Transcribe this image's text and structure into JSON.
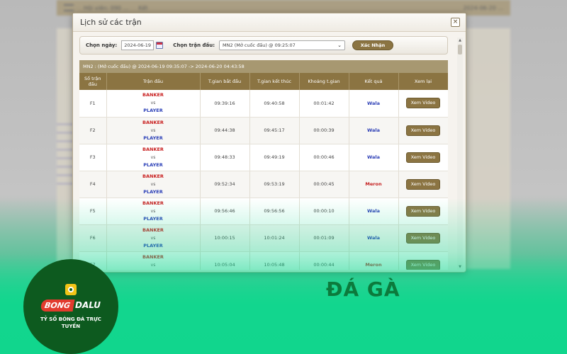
{
  "background": {
    "topbar_left": "Hội viên: 090 ...",
    "topbar_user": "Kết",
    "topbar_right": "2024-06-20 ..."
  },
  "dialog": {
    "title": "Lịch sử các trận",
    "close_glyph": "×",
    "filter": {
      "date_label": "Chọn ngày:",
      "date_value": "2024-06-19",
      "match_label": "Chọn trận đấu:",
      "match_value": "MN2 (Mở cuốc đấu)  @  09:25:07",
      "confirm_label": "Xác Nhận"
    },
    "summary": "MN2 : (Mở cuốc đấu)  @  2024-06-19 09:35:07 -> 2024-06-20 04:43:58",
    "columns": [
      "Số trận đấu",
      "Trận đấu",
      "T.gian bắt đầu",
      "T.gian kết thúc",
      "Khoảng t.gian",
      "Kết quả",
      "Xem lại"
    ],
    "match_side_a": "BANKER",
    "match_vs": "vs",
    "match_side_b": "PLAYER",
    "video_label": "Xem Video",
    "rows": [
      {
        "id": "F1",
        "start": "09:39:16",
        "end": "09:40:58",
        "duration": "00:01:42",
        "result": "Wala"
      },
      {
        "id": "F2",
        "start": "09:44:38",
        "end": "09:45:17",
        "duration": "00:00:39",
        "result": "Wala"
      },
      {
        "id": "F3",
        "start": "09:48:33",
        "end": "09:49:19",
        "duration": "00:00:46",
        "result": "Wala"
      },
      {
        "id": "F4",
        "start": "09:52:34",
        "end": "09:53:19",
        "duration": "00:00:45",
        "result": "Meron"
      },
      {
        "id": "F5",
        "start": "09:56:46",
        "end": "09:56:56",
        "duration": "00:00:10",
        "result": "Wala"
      },
      {
        "id": "F6",
        "start": "10:00:15",
        "end": "10:01:24",
        "duration": "00:01:09",
        "result": "Wala"
      },
      {
        "id": "F7",
        "start": "10:05:04",
        "end": "10:05:48",
        "duration": "00:00:44",
        "result": "Meron"
      }
    ]
  },
  "overlay": {
    "headline": "ĐÁ GÀ",
    "brand_part_a": "BONG",
    "brand_part_b": "DALU",
    "tagline": "TỶ SỐ BÓNG ĐÁ TRỰC TUYẾN"
  },
  "colors": {
    "accent": "#8b7442",
    "wala": "#2b3db5",
    "meron": "#c41e1e",
    "banker": "#c81e1e",
    "player": "#2a3fb7"
  }
}
